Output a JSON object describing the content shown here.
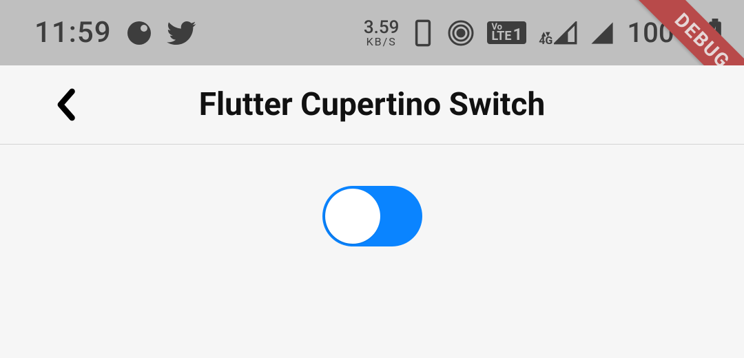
{
  "status": {
    "time": "11:59",
    "speed_value": "3.59",
    "speed_unit": "KB/S",
    "volte_top": "Vo",
    "volte_bot": "LTE",
    "volte_num": "1",
    "network_label": "4G",
    "battery_percent": "100%"
  },
  "debug_banner": "DEBUG",
  "nav": {
    "title": "Flutter Cupertino Switch"
  },
  "switch": {
    "on": true,
    "active_color": "#0a84ff"
  }
}
